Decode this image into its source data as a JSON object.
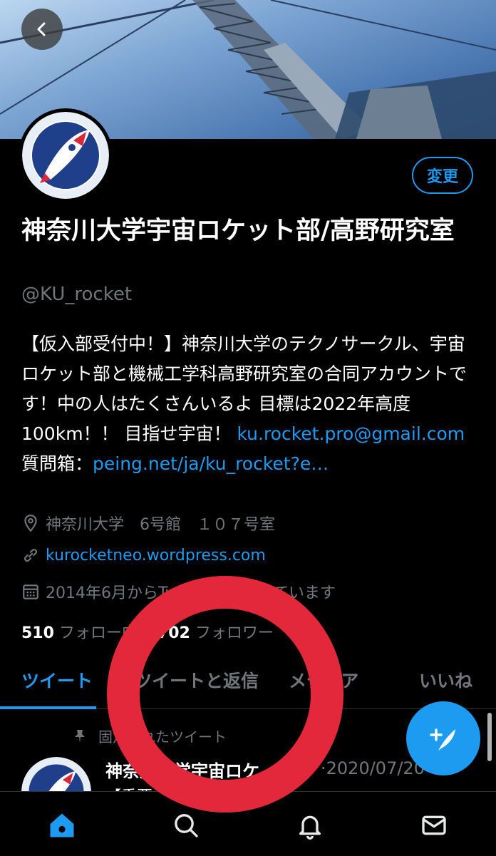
{
  "header": {
    "back_icon": "chevron-left-icon",
    "edit_button_label": "変更"
  },
  "profile": {
    "display_name": "神奈川大学宇宙ロケット部/高野研究室",
    "handle": "@KU_rocket",
    "bio_text": "【仮入部受付中！】神奈川大学のテクノサークル、宇宙ロケット部と機械工学科高野研究室の合同アカウントです！中の人はたくさんいるよ 目標は2022年高度 100km！！ 目指せ宇宙！ ",
    "bio_email": "ku.rocket.pro@gmail.com",
    "bio_mid": " 質問箱：",
    "bio_link": "peing.net/ja/ku_rocket?e…",
    "location": "神奈川大学　6号館　１０７号室",
    "website": "kurocketneo.wordpress.com",
    "joined": "2014年6月からTwitterを利用しています",
    "following_count": "510",
    "following_label": "フォロー中",
    "followers_count": "702",
    "followers_label": "フォロワー"
  },
  "tabs": [
    {
      "label": "ツイート",
      "active": true
    },
    {
      "label": "ツイートと返信",
      "active": false
    },
    {
      "label": "メディア",
      "active": false
    },
    {
      "label": "いいね",
      "active": false
    }
  ],
  "pinned_tweet": {
    "pin_label": "固定されたツイート",
    "author": "神奈川大学宇宙ロケ…",
    "date": "·2020/07/20",
    "text": "【重要なお知らせ】"
  },
  "bottom_nav": [
    {
      "icon": "home-icon",
      "active": true
    },
    {
      "icon": "search-icon",
      "active": false
    },
    {
      "icon": "bell-icon",
      "active": false
    },
    {
      "icon": "mail-icon",
      "active": false
    }
  ],
  "colors": {
    "accent": "#1d9bf0",
    "background": "#000000",
    "overlay_ring": "#e2283a"
  }
}
